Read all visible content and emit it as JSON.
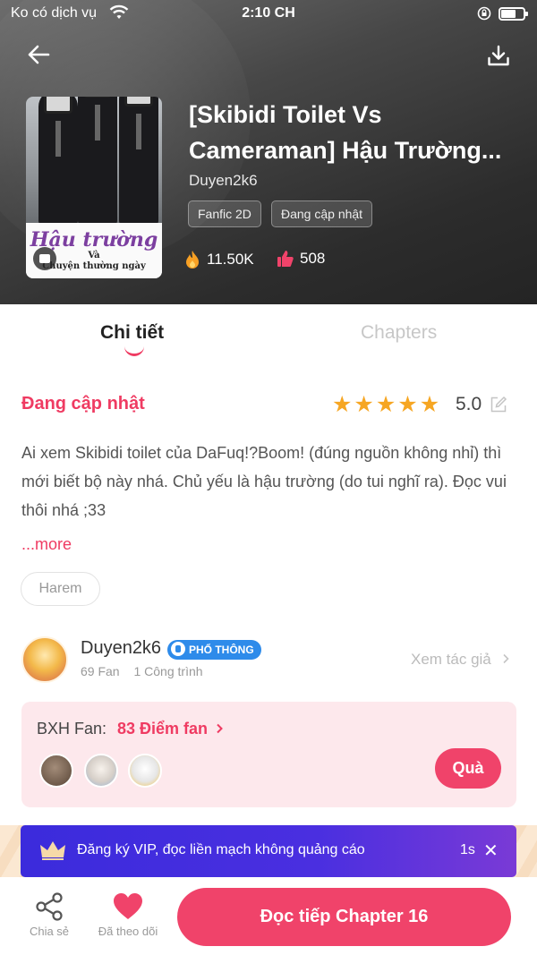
{
  "status_bar": {
    "carrier": "Ko có dịch vụ",
    "time": "2:10 CH"
  },
  "header": {
    "back_icon": "back-arrow-icon",
    "download_icon": "download-icon",
    "cover": {
      "title": "Hậu trường",
      "subtitle_line1": "Và",
      "subtitle_line2": "Chuyện thường ngày"
    },
    "title": "[Skibidi Toilet Vs Cameraman] Hậu Trường...",
    "author": "Duyen2k6",
    "tags": [
      "Fanfic 2D",
      "Đang cập nhật"
    ],
    "stats": {
      "views": "11.50K",
      "likes": "508"
    }
  },
  "tabs": [
    {
      "label": "Chi tiết",
      "active": true
    },
    {
      "label": "Chapters",
      "active": false
    }
  ],
  "details": {
    "status": "Đang cập nhật",
    "rating": "5.0",
    "stars_filled": 5,
    "description": "Ai xem Skibidi toilet của DaFuq!?Boom! (đúng nguồn không nhỉ) thì mới biết bộ này nhá. Chủ yếu là hậu trường (do tui nghĩ ra). Đọc vui thôi nhá ;33",
    "more_label": "...more",
    "genres": [
      "Harem"
    ]
  },
  "author_card": {
    "name": "Duyen2k6",
    "level_badge": "PHỔ THÔNG",
    "fans": "69 Fan",
    "works": "1 Công trình",
    "view_label": "Xem tác giả"
  },
  "fan_board": {
    "label": "BXH Fan:",
    "score": "83 Điểm fan",
    "gift_button": "Quà",
    "avatars": [
      "fan-avatar-1",
      "fan-avatar-2",
      "fan-avatar-3"
    ]
  },
  "vip_banner": {
    "text": "Đăng ký VIP, đọc liền mạch không quảng cáo",
    "timer": "1s"
  },
  "bottom_bar": {
    "share_label": "Chia sẻ",
    "follow_label": "Đã theo dõi",
    "read_label": "Đọc tiếp Chapter 16"
  },
  "colors": {
    "accent": "#ef3b62",
    "star": "#f6a623",
    "badge_blue": "#2e8bea",
    "vip_purple": "#3b2bdc"
  }
}
